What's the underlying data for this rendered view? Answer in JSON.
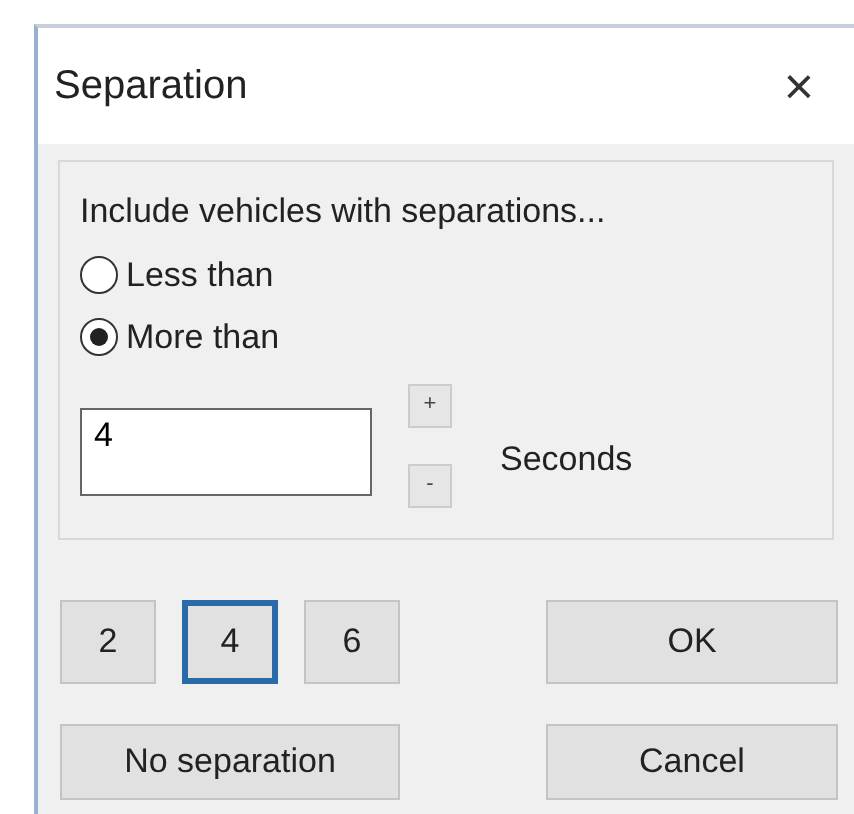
{
  "window": {
    "title": "Separation",
    "close": "×"
  },
  "group": {
    "label": "Include vehicles with separations...",
    "options": [
      {
        "label": "Less than",
        "selected": false
      },
      {
        "label": "More than",
        "selected": true
      }
    ],
    "value": "4",
    "increment": "+",
    "decrement": "-",
    "unit": "Seconds"
  },
  "presets": [
    {
      "label": "2",
      "selected": false
    },
    {
      "label": "4",
      "selected": true
    },
    {
      "label": "6",
      "selected": false
    }
  ],
  "buttons": {
    "ok": "OK",
    "no_separation": "No separation",
    "cancel": "Cancel"
  }
}
